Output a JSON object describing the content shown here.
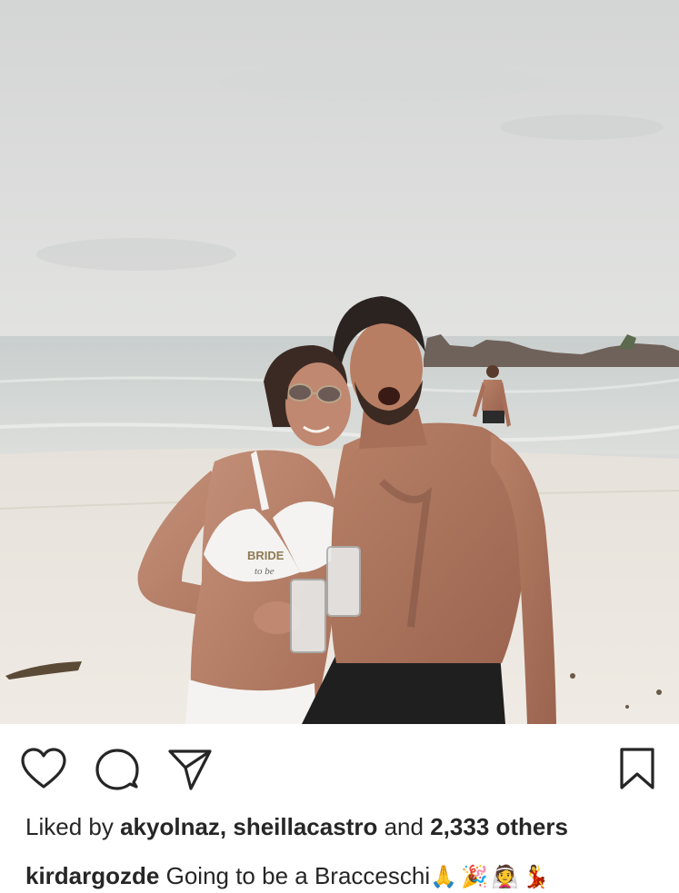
{
  "post": {
    "likes": {
      "prefix": "Liked by",
      "user1": "akyolnaz,",
      "user2": "sheillacastro",
      "conjunction": "and",
      "count": "2,333 others"
    },
    "caption": {
      "username": "kirdargozde",
      "text": "Going to be a Bracceschi",
      "emojis": "🙏🎉👰💃"
    },
    "photo": {
      "bikini_text_1": "BRIDE",
      "bikini_text_2": "to be"
    },
    "actions": {
      "like_icon": "heart-icon",
      "comment_icon": "comment-icon",
      "share_icon": "paper-plane-icon",
      "save_icon": "bookmark-icon"
    },
    "colors": {
      "text": "#262626",
      "sky": "#d9dada",
      "sand": "#ece7df",
      "sea": "#cfd3d2"
    }
  }
}
